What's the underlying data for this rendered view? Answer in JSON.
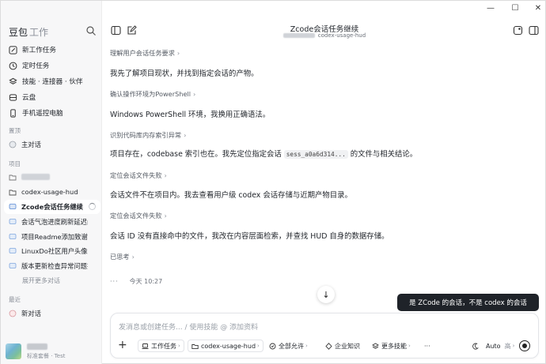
{
  "app": {
    "brand": "豆包",
    "brand_sub": "工作"
  },
  "window_controls": {
    "minimize": "—",
    "maximize": "☐",
    "close": "✕"
  },
  "sidebar": {
    "nav": [
      {
        "label": "新工作任务",
        "icon": "edit-icon"
      },
      {
        "label": "定时任务",
        "icon": "clock-icon"
      },
      {
        "label": "技能 · 连接器 · 伙伴",
        "icon": "layers-icon"
      },
      {
        "label": "云盘",
        "icon": "cloud-icon"
      },
      {
        "label": "手机遥控电脑",
        "icon": "phone-icon"
      }
    ],
    "pinned_label": "置顶",
    "pinned": [
      {
        "label": "主对话"
      }
    ],
    "projects_label": "项目",
    "projects": [
      {
        "label": ""
      },
      {
        "label": "codex-usage-hud"
      }
    ],
    "threads": [
      {
        "label": "Zcode会话任务继续",
        "active": true
      },
      {
        "label": "会话气泡进度刷新延迟问题"
      },
      {
        "label": "项目Readme添加致谢模块"
      },
      {
        "label": "LinuxDo社区用户头像设置"
      },
      {
        "label": "版本更新检查异常问题排查"
      }
    ],
    "more_label": "展开更多对话",
    "recent_label": "最近",
    "recent": [
      {
        "label": "新对话"
      }
    ],
    "user_sub": "标准套餐 · Test"
  },
  "header": {
    "title": "Zcode会话任务继续",
    "subtitle": "codex-usage-hud"
  },
  "messages": [
    {
      "step": "理解用户会话任务要求",
      "text": "我先了解项目现状，并找到指定会话的产物。"
    },
    {
      "step": "确认操作环境为PowerShell",
      "text": "Windows PowerShell 环境，我换用正确语法。"
    },
    {
      "step": "识别代码库内存索引异常",
      "text_before": "项目存在，codebase 索引也在。我先定位指定会话",
      "code": "sess_a0a6d314...",
      "text_after": "的文件与相关结论。"
    },
    {
      "step": "定位会话文件失败",
      "text": "会话文件不在项目内。我去查看用户级 codex 会话存储与近期产物目录。"
    },
    {
      "step": "定位会话文件失败",
      "text": "会话 ID 没有直接命中的文件，我改在内容层面检索，并查找 HUD 自身的数据存储。"
    },
    {
      "step": "已思考",
      "text": ""
    }
  ],
  "meta": {
    "dots": "···",
    "time": "今天 10:27"
  },
  "tooltip": "是 ZCode 的会话，不是 codex 的会话",
  "composer": {
    "placeholder": "发消息或创建任务... / 使用技能 @ 添加资料",
    "chips": {
      "work_task": "工作任务",
      "project": "codex-usage-hud",
      "permission": "全部允许",
      "knowledge": "企业知识",
      "skills": "更多技能",
      "more": "···",
      "model": "Auto",
      "level": "高"
    }
  },
  "colors": {
    "accent": "#1f2329",
    "active_bg": "#ffffff",
    "sidebar_bg": "#f7f7f8"
  }
}
